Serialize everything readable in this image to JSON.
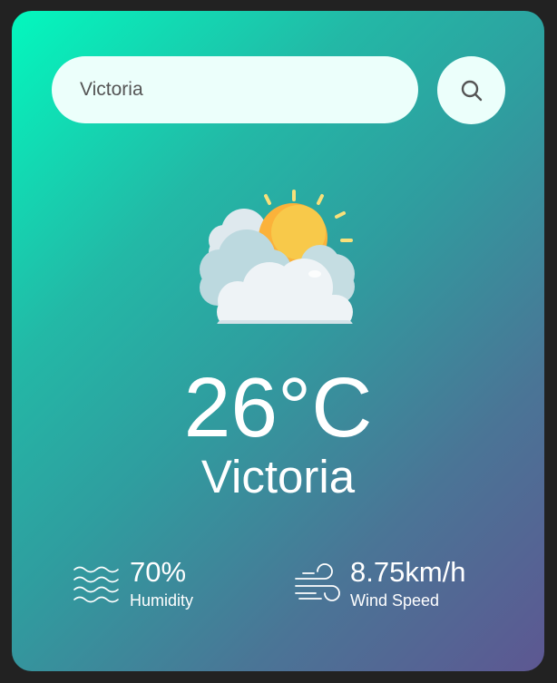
{
  "search": {
    "value": "Victoria",
    "button_icon": "search-icon"
  },
  "weather": {
    "icon": "partly-cloudy-sun-icon",
    "temperature": "26°C",
    "city": "Victoria"
  },
  "stats": {
    "humidity": {
      "value": "70%",
      "label": "Humidity",
      "icon": "humidity-waves-icon"
    },
    "wind": {
      "value": "8.75km/h",
      "label": "Wind Speed",
      "icon": "wind-icon"
    }
  },
  "colors": {
    "background": "#222222",
    "gradient_start": "#03f8be",
    "gradient_end": "#5d5792",
    "input_background": "#ecfffb",
    "text": "#ffffff",
    "sun": "#fbb23a",
    "sun_rays": "#f8e07a"
  }
}
